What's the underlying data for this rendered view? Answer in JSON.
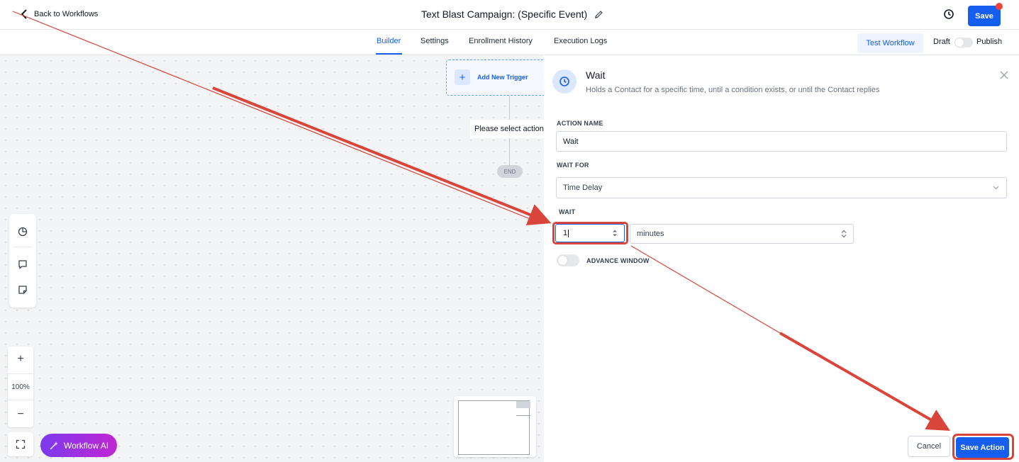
{
  "header": {
    "back_label": "Back to Workflows",
    "title": "Text Blast Campaign: (Specific Event)",
    "save_label": "Save"
  },
  "tabs": [
    {
      "label": "Builder",
      "active": true
    },
    {
      "label": "Settings",
      "active": false
    },
    {
      "label": "Enrollment History",
      "active": false
    },
    {
      "label": "Execution Logs",
      "active": false
    }
  ],
  "actions": {
    "test_label": "Test Workflow",
    "draft_label": "Draft",
    "publish_label": "Publish"
  },
  "canvas": {
    "trigger_label": "Add New Trigger",
    "placeholder_action": "Please select action",
    "end_label": "END",
    "zoom_level": "100%",
    "ai_label": "Workflow AI"
  },
  "panel": {
    "title": "Wait",
    "description": "Holds a Contact for a specific time, until a condition exists, or until the Contact replies",
    "action_name_label": "ACTION NAME",
    "action_name_value": "Wait",
    "wait_for_label": "WAIT FOR",
    "wait_for_value": "Time Delay",
    "wait_label": "WAIT",
    "wait_amount": "1",
    "wait_unit": "minutes",
    "advance_window_label": "ADVANCE WINDOW",
    "cancel_label": "Cancel",
    "save_action_label": "Save Action"
  },
  "colors": {
    "primary": "#155eef",
    "annotation": "#d9453a",
    "ai_gradient_start": "#7c3aed",
    "ai_gradient_end": "#c026d3"
  }
}
